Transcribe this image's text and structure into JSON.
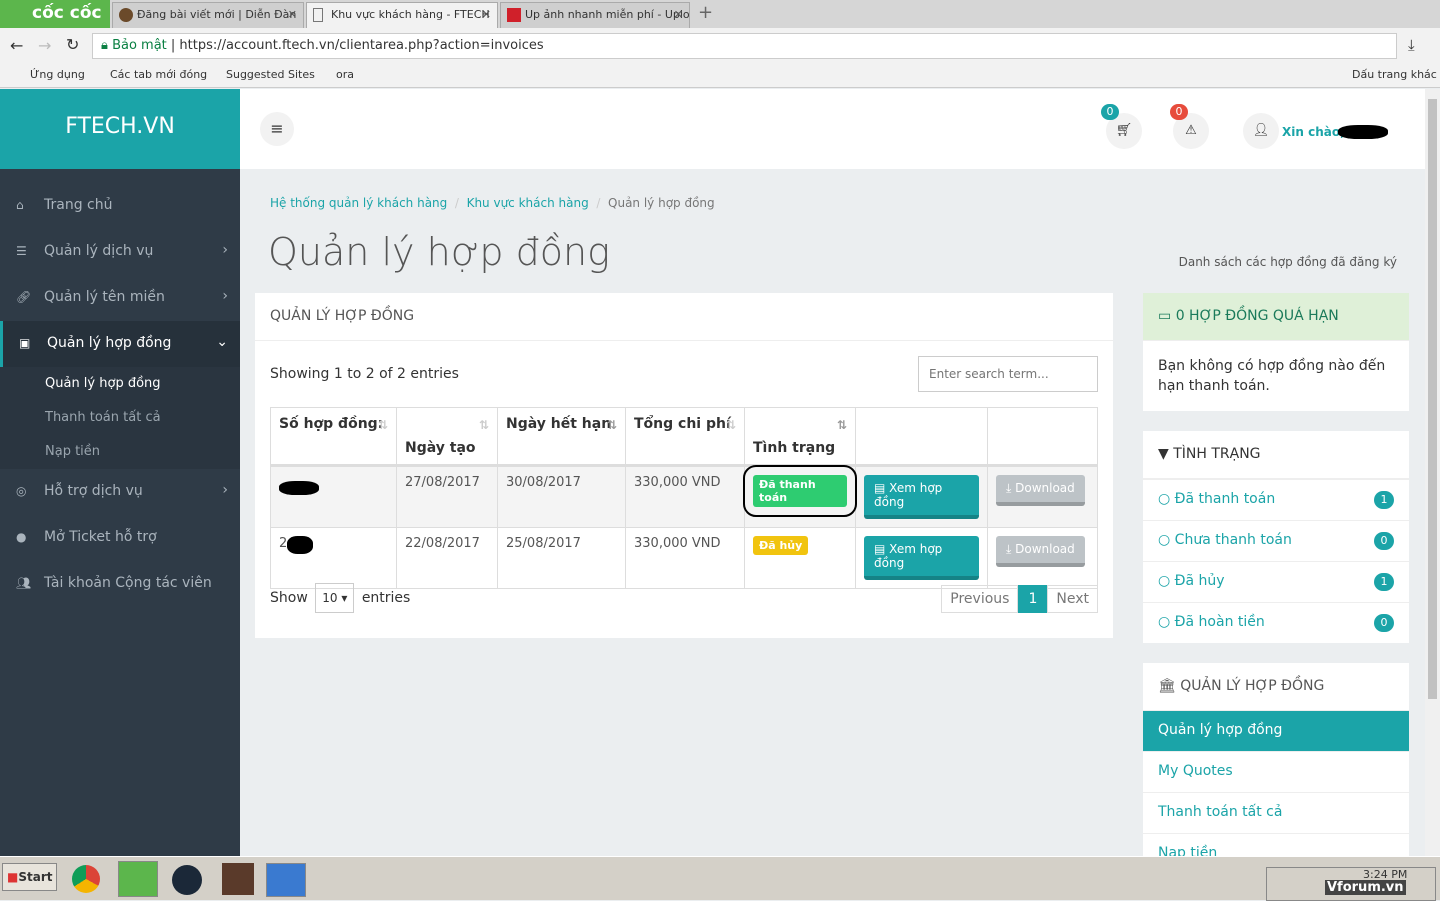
{
  "browser": {
    "brand": "cốc cốc",
    "tabs": [
      {
        "title": "Đăng bài viết mới | Diễn Đàn"
      },
      {
        "title": "Khu vực khách hàng - FTECH"
      },
      {
        "title": "Up ảnh nhanh miễn phí - Uplo"
      }
    ],
    "secure_label": "Bảo mật",
    "url": "https://account.ftech.vn/clientarea.php?action=invoices",
    "bookmarks": [
      "Ứng dụng",
      "Các tab mới đóng",
      "Suggested Sites",
      "ora"
    ],
    "other_bookmarks": "Dấu trang khác"
  },
  "sidebar": {
    "brand": "FTECH.VN",
    "items": [
      {
        "label": "Trang chủ"
      },
      {
        "label": "Quản lý dịch vụ"
      },
      {
        "label": "Quản lý tên miền"
      },
      {
        "label": "Quản lý hợp đồng"
      },
      {
        "label": "Hỗ trợ dịch vụ"
      },
      {
        "label": "Mở Ticket hỗ trợ"
      },
      {
        "label": "Tài khoản Cộng tác viên"
      }
    ],
    "subitems": [
      "Quản lý hợp đồng",
      "Thanh toán tất cả",
      "Nạp tiền"
    ]
  },
  "header": {
    "cart_count": "0",
    "alert_count": "0",
    "greeting": "Xin chào,"
  },
  "breadcrumb": [
    "Hệ thống quản lý khách hàng",
    "Khu vực khách hàng",
    "Quản lý hợp đồng"
  ],
  "page": {
    "title": "Quản lý hợp đồng",
    "subtitle": "Danh sách các hợp đồng đã đăng ký"
  },
  "main": {
    "panel_title": "QUẢN LÝ HỢP ĐỒNG",
    "showing": "Showing 1 to 2 of 2 entries",
    "search_placeholder": "Enter search term...",
    "columns": [
      "Số hợp đồng:",
      "Ngày tạo",
      "Ngày hết hạn",
      "Tổng chi phí",
      "Tình trạng"
    ],
    "rows": [
      {
        "number": "",
        "created": "27/08/2017",
        "expires": "30/08/2017",
        "total": "330,000 VND",
        "status": "Đã thanh toán",
        "view": "Xem hợp đồng",
        "download": "Download"
      },
      {
        "number": "2",
        "created": "22/08/2017",
        "expires": "25/08/2017",
        "total": "330,000 VND",
        "status": "Đã hủy",
        "view": "Xem hợp đồng",
        "download": "Download"
      }
    ],
    "show": "Show",
    "page_size": "10",
    "entries": "entries",
    "prev": "Previous",
    "page": "1",
    "next": "Next"
  },
  "right": {
    "overdue_title": "0 HỢP ĐỒNG QUÁ HẠN",
    "overdue_text": "Bạn không có hợp đồng nào đến hạn thanh toán.",
    "status_title": "TÌNH TRẠNG",
    "statuses": [
      {
        "label": "Đã thanh toán",
        "count": "1"
      },
      {
        "label": "Chưa thanh toán",
        "count": "0"
      },
      {
        "label": "Đã hủy",
        "count": "1"
      },
      {
        "label": "Đã hoàn tiền",
        "count": "0"
      }
    ],
    "manage_title": "QUẢN LÝ HỢP ĐỒNG",
    "manage_items": [
      "Quản lý hợp đồng",
      "My Quotes",
      "Thanh toán tất cả",
      "Nạp tiền"
    ]
  },
  "taskbar": {
    "start": "Start",
    "time": "3:24 PM",
    "watermark": "Vforum.vn"
  }
}
